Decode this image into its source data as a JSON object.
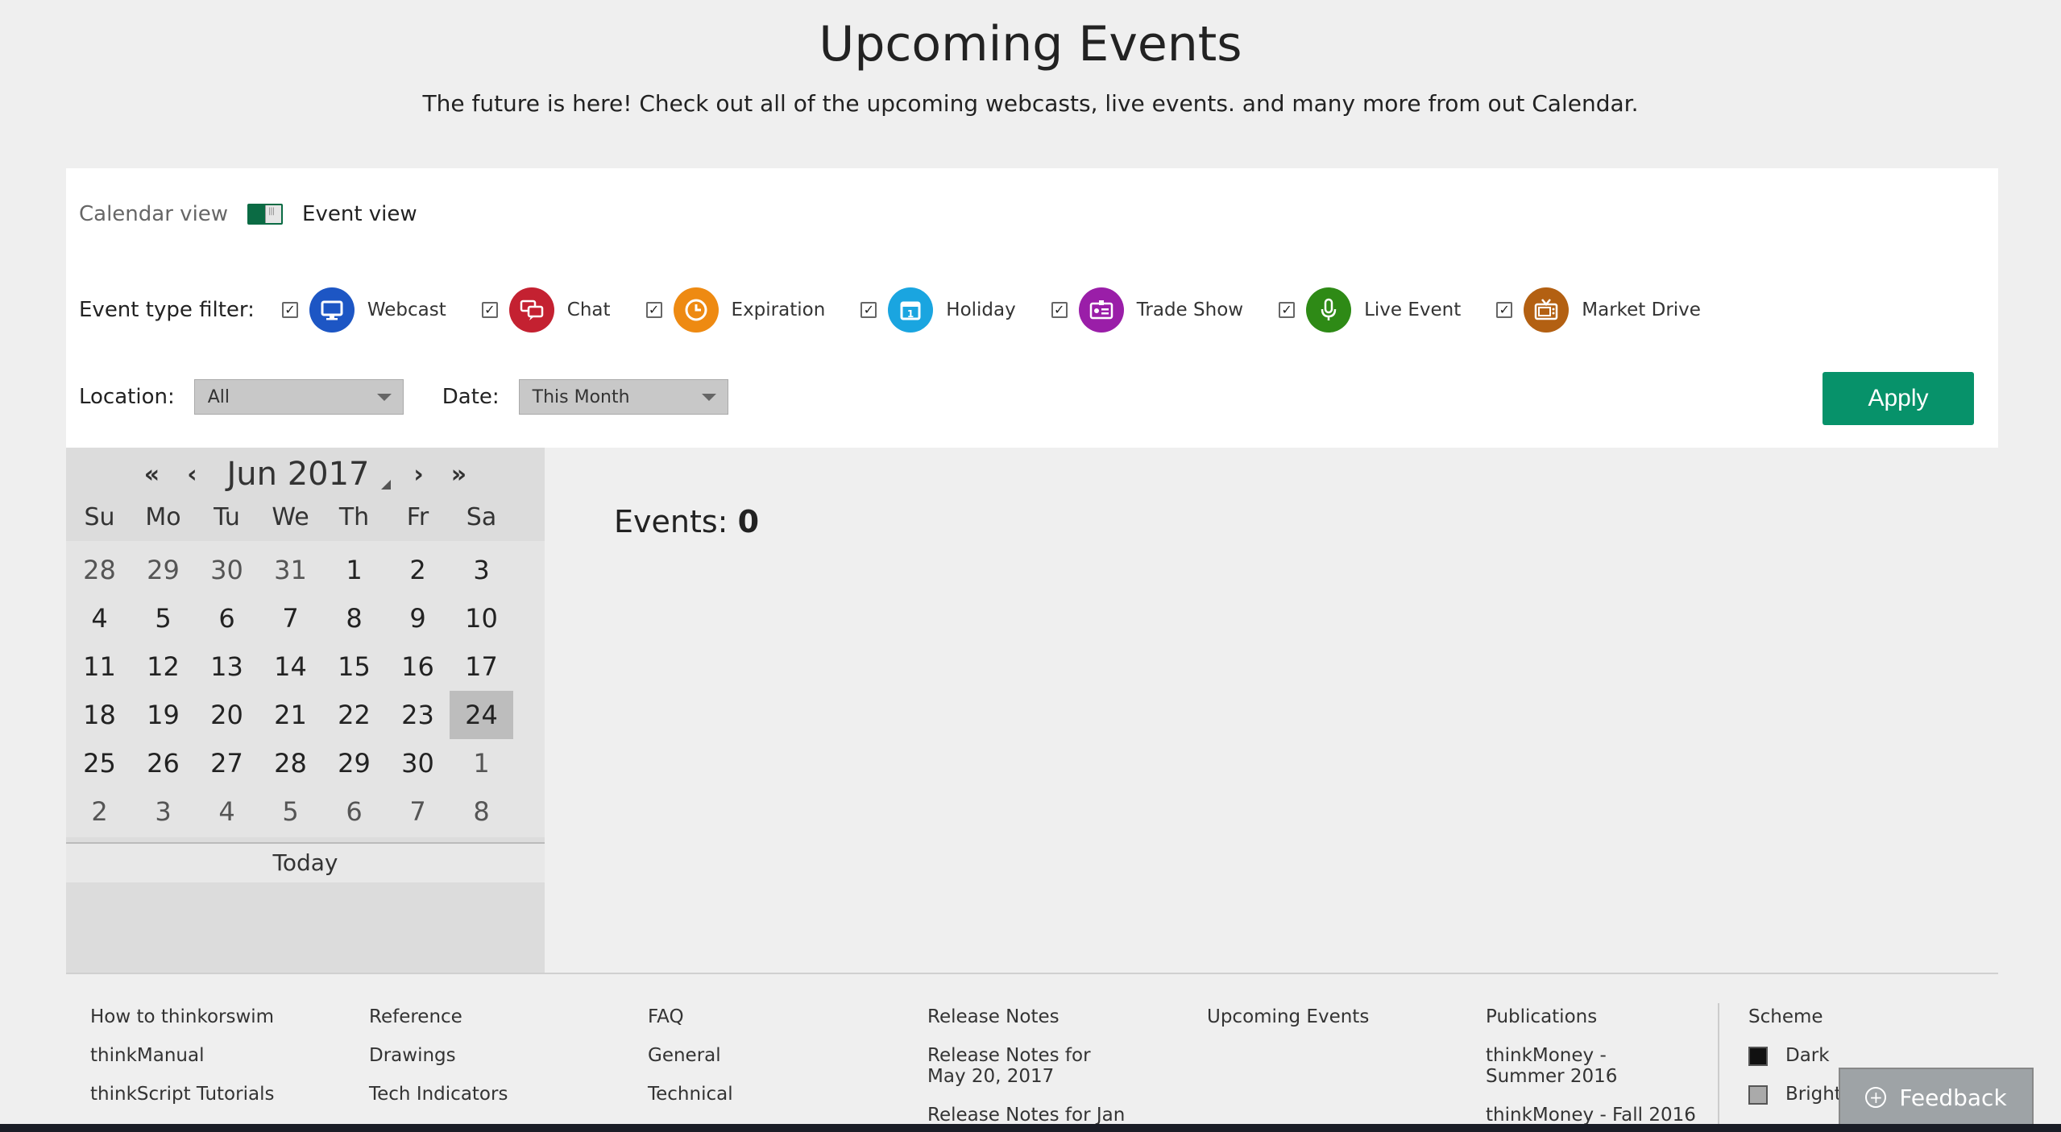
{
  "header": {
    "title": "Upcoming Events",
    "subtitle": "The future is here! Check out all of the upcoming webcasts, live events. and many more from out Calendar."
  },
  "view_toggle": {
    "calendar_label": "Calendar view",
    "event_label": "Event view"
  },
  "filters": {
    "label": "Event type filter:",
    "items": [
      {
        "name": "Webcast",
        "checked": true,
        "color": "#1d56c4",
        "icon": "monitor-icon"
      },
      {
        "name": "Chat",
        "checked": true,
        "color": "#c42131",
        "icon": "chat-bubbles-icon"
      },
      {
        "name": "Expiration",
        "checked": true,
        "color": "#ee8a12",
        "icon": "clock-icon"
      },
      {
        "name": "Holiday",
        "checked": true,
        "color": "#1aa5e0",
        "icon": "calendar-day-icon"
      },
      {
        "name": "Trade Show",
        "checked": true,
        "color": "#9a1ea8",
        "icon": "badge-icon"
      },
      {
        "name": "Live Event",
        "checked": true,
        "color": "#2e8a16",
        "icon": "microphone-icon"
      },
      {
        "name": "Market Drive",
        "checked": true,
        "color": "#b36012",
        "icon": "tv-icon"
      }
    ]
  },
  "location": {
    "label": "Location:",
    "value": "All"
  },
  "date": {
    "label": "Date:",
    "value": "This Month"
  },
  "apply_label": "Apply",
  "calendar": {
    "month": "Jun 2017",
    "weekdays": [
      "Su",
      "Mo",
      "Tu",
      "We",
      "Th",
      "Fr",
      "Sa"
    ],
    "weeks": [
      [
        "28",
        "29",
        "30",
        "31",
        "1",
        "2",
        "3"
      ],
      [
        "4",
        "5",
        "6",
        "7",
        "8",
        "9",
        "10"
      ],
      [
        "11",
        "12",
        "13",
        "14",
        "15",
        "16",
        "17"
      ],
      [
        "18",
        "19",
        "20",
        "21",
        "22",
        "23",
        "24"
      ],
      [
        "25",
        "26",
        "27",
        "28",
        "29",
        "30",
        "1"
      ],
      [
        "2",
        "3",
        "4",
        "5",
        "6",
        "7",
        "8"
      ]
    ],
    "selected": "24",
    "today_label": "Today"
  },
  "events": {
    "label": "Events:",
    "count": "0"
  },
  "footer": {
    "col1": [
      "How to thinkorswim",
      "thinkManual",
      "thinkScript Tutorials"
    ],
    "col2": [
      "Reference",
      "Drawings",
      "Tech Indicators"
    ],
    "col3": [
      "FAQ",
      "General",
      "Technical"
    ],
    "col4": [
      "Release Notes",
      "Release Notes for May 20, 2017",
      "Release Notes for Jan"
    ],
    "col5": [
      "Upcoming Events"
    ],
    "col6": [
      "Publications",
      "thinkMoney - Summer 2016",
      "thinkMoney - Fall 2016"
    ],
    "scheme": {
      "title": "Scheme",
      "dark": "Dark",
      "bright": "Bright"
    }
  },
  "feedback_label": "Feedback",
  "colors": {
    "accent": "#07926a",
    "toggle": "#0b6b44"
  }
}
